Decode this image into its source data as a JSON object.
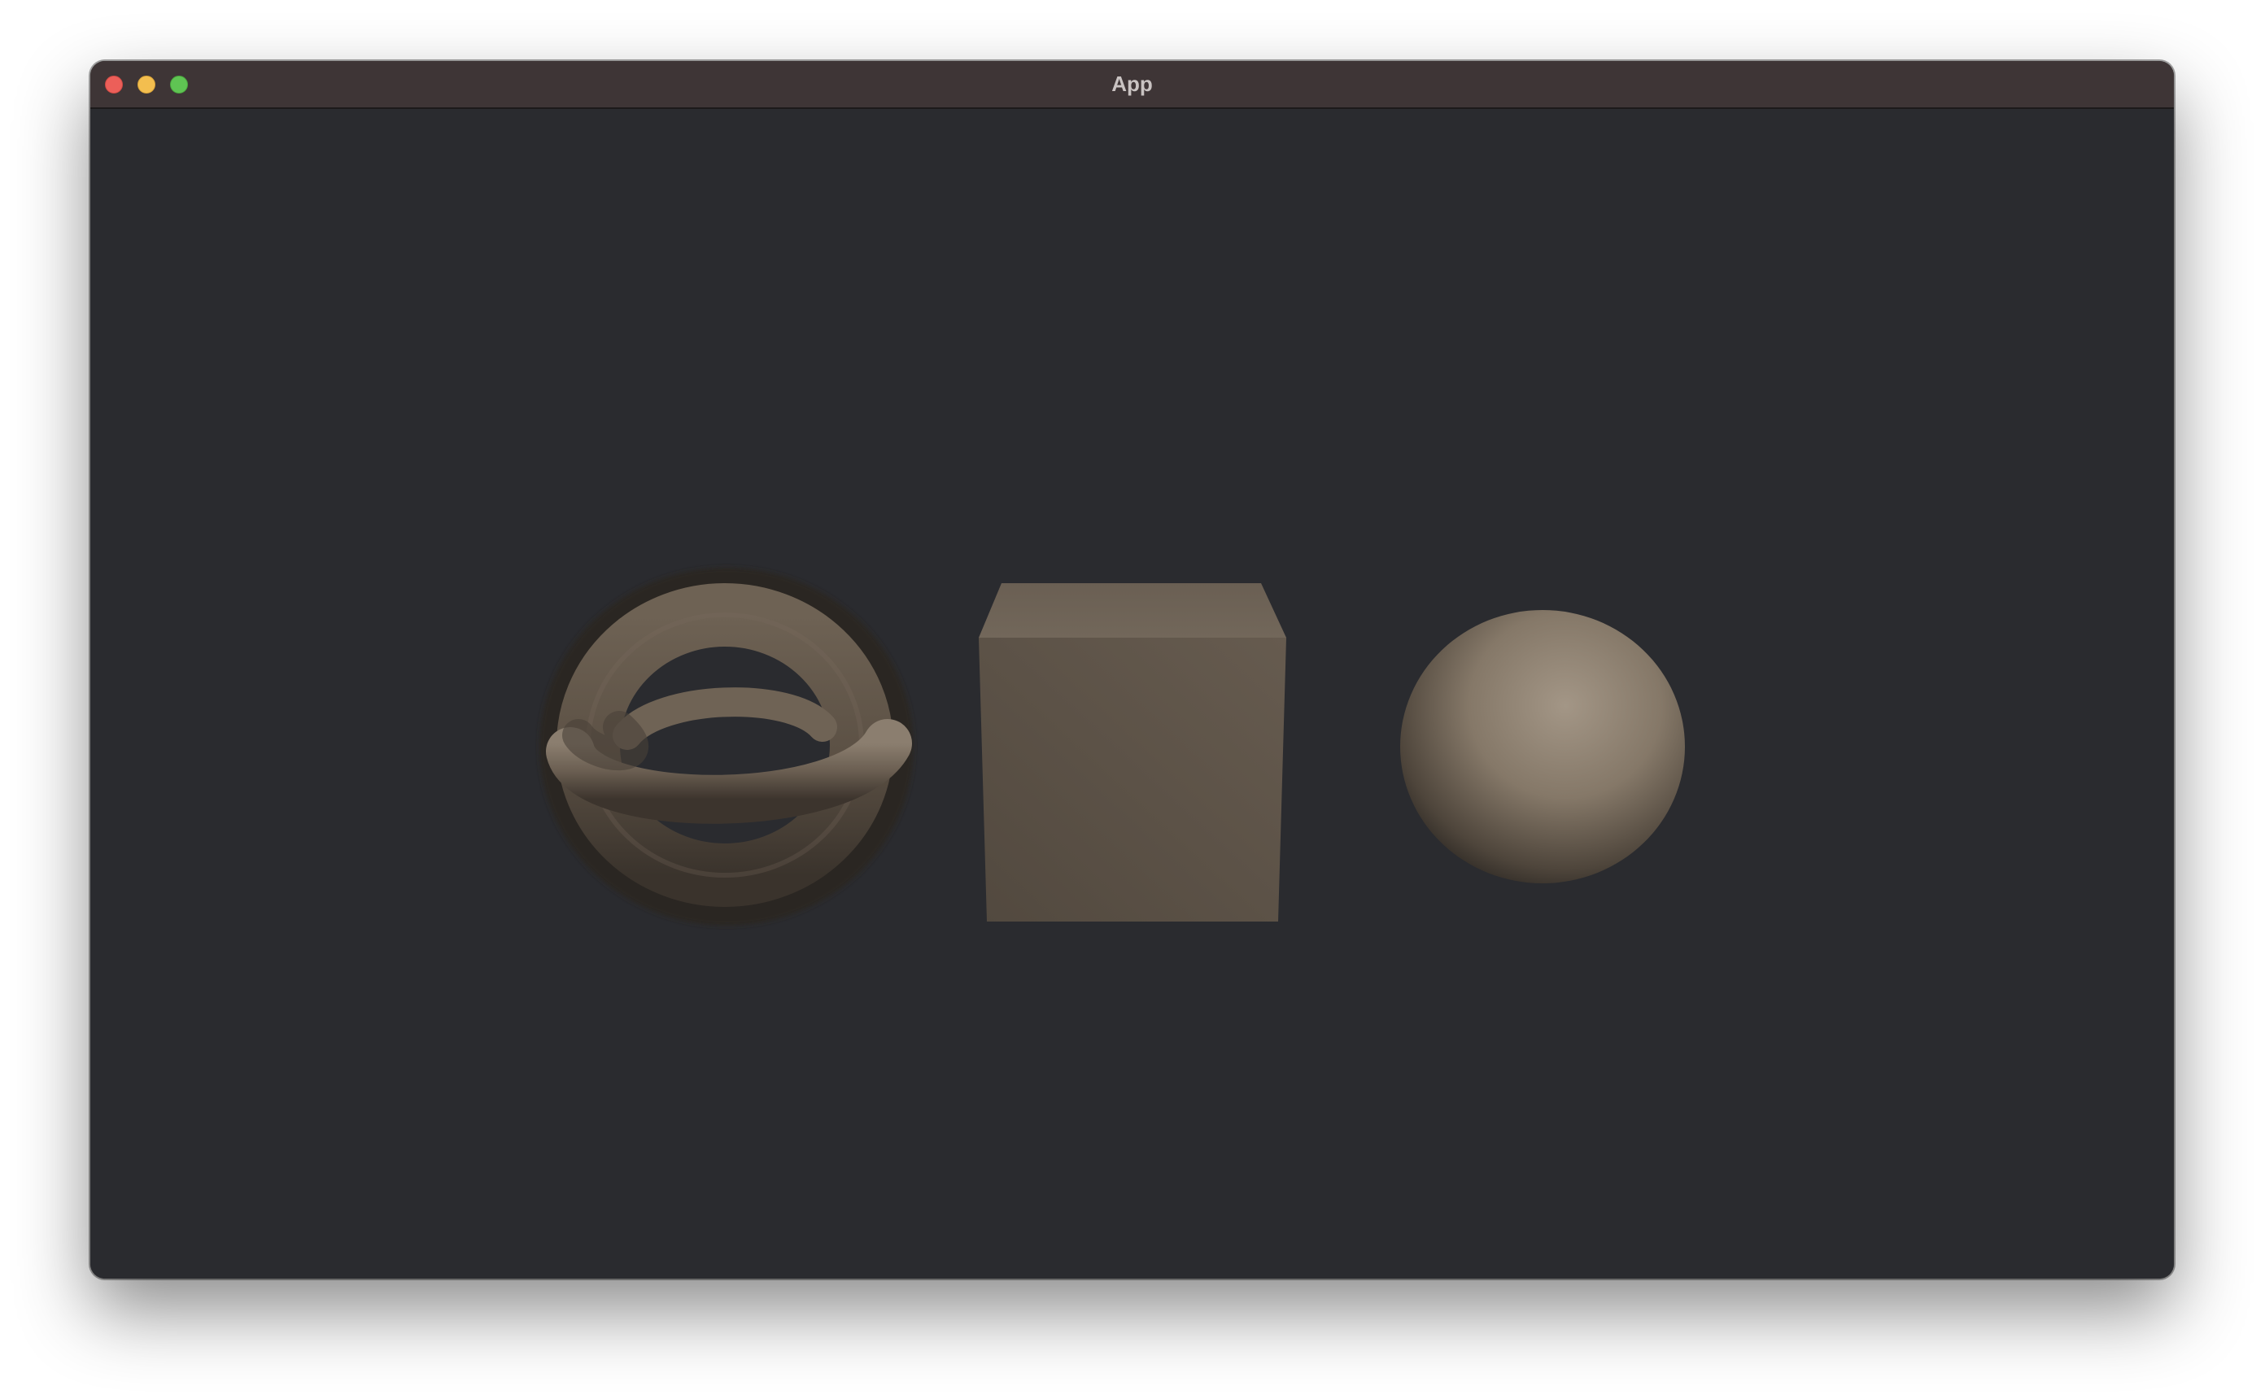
{
  "window": {
    "title": "App",
    "controls": [
      "close",
      "minimize",
      "zoom"
    ]
  },
  "scene": {
    "background_color": "#2a2b2f",
    "objects": [
      {
        "name": "torus-knot",
        "color": "#6e6254"
      },
      {
        "name": "cube",
        "color": "#6a5f52"
      },
      {
        "name": "sphere",
        "color": "#8a7e70"
      }
    ]
  }
}
